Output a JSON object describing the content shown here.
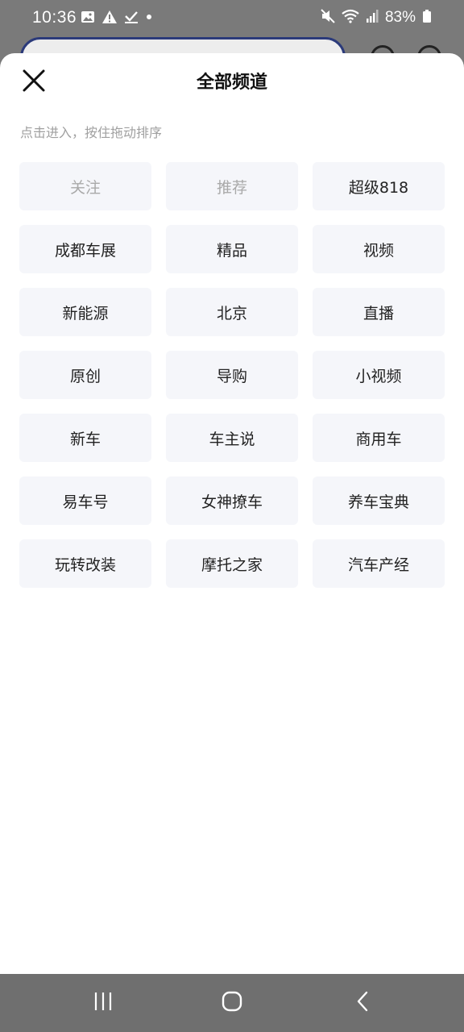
{
  "status_bar": {
    "time": "10:36",
    "battery": "83%",
    "left_icons": [
      "image-icon",
      "warning-icon",
      "check-icon",
      "dot-icon"
    ],
    "right_icons": [
      "mute-icon",
      "wifi-icon",
      "signal-icon",
      "battery-icon"
    ]
  },
  "sheet": {
    "title": "全部频道",
    "hint": "点击进入，按住拖动排序",
    "close_icon": "close-icon"
  },
  "channels": [
    {
      "label": "关注",
      "fixed": true
    },
    {
      "label": "推荐",
      "fixed": true
    },
    {
      "label": "超级818",
      "fixed": false
    },
    {
      "label": "成都车展",
      "fixed": false
    },
    {
      "label": "精品",
      "fixed": false
    },
    {
      "label": "视频",
      "fixed": false
    },
    {
      "label": "新能源",
      "fixed": false
    },
    {
      "label": "北京",
      "fixed": false
    },
    {
      "label": "直播",
      "fixed": false
    },
    {
      "label": "原创",
      "fixed": false
    },
    {
      "label": "导购",
      "fixed": false
    },
    {
      "label": "小视频",
      "fixed": false
    },
    {
      "label": "新车",
      "fixed": false
    },
    {
      "label": "车主说",
      "fixed": false
    },
    {
      "label": "商用车",
      "fixed": false
    },
    {
      "label": "易车号",
      "fixed": false
    },
    {
      "label": "女神撩车",
      "fixed": false
    },
    {
      "label": "养车宝典",
      "fixed": false
    },
    {
      "label": "玩转改装",
      "fixed": false
    },
    {
      "label": "摩托之家",
      "fixed": false
    },
    {
      "label": "汽车产经",
      "fixed": false
    }
  ],
  "nav_bar": {
    "icons": [
      "recent-apps-icon",
      "home-icon",
      "back-icon"
    ]
  },
  "colors": {
    "chip_bg": "#f5f6fa",
    "chip_text": "#222222",
    "chip_fixed_text": "#a9a9a9",
    "hint_text": "#a0a0a0",
    "nav_bar": "#6f6f6f"
  }
}
